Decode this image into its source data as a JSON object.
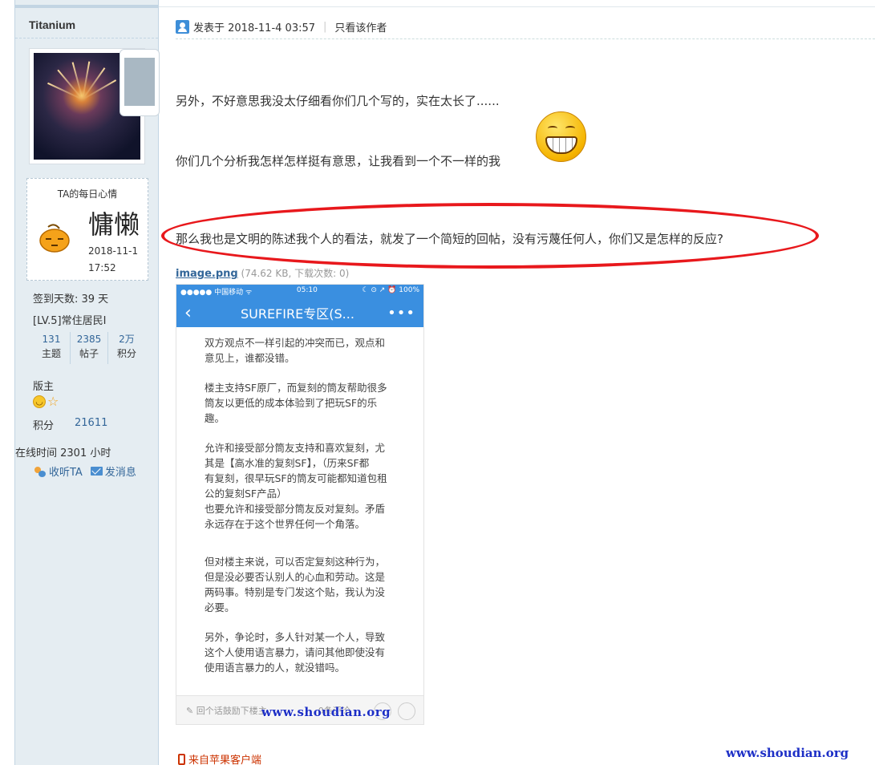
{
  "sidebar": {
    "username": "Titanium",
    "mood": {
      "title": "TA的每日心情",
      "word": "慵懒",
      "date": "2018-11-1",
      "time": "17:52"
    },
    "checkin": "签到天数: 39 天",
    "level": "[LV.5]常住居民I",
    "counts": [
      {
        "num": "131",
        "label": "主题"
      },
      {
        "num": "2385",
        "label": "帖子"
      },
      {
        "num": "2万",
        "label": "积分"
      }
    ],
    "role": "版主",
    "score_label": "积分",
    "score_value": "21611",
    "online": "在线时间  2301 小时",
    "follow_label": "收听TA",
    "message_label": "发消息"
  },
  "post": {
    "meta_time": "发表于 2018-11-4 03:57",
    "meta_sep": "|",
    "meta_author_only": "只看该作者",
    "para1": "另外，不好意思我没太仔细看你们几个写的，实在太长了......",
    "para2": "你们几个分析我怎样怎样挺有意思，让我看到一个不一样的我",
    "para3": "那么我也是文明的陈述我个人的看法，就发了一个简短的回帖，没有污蔑任何人，你们又是怎样的反应?",
    "attachment_name": "image.png",
    "attachment_info": "(74.62 KB, 下载次数: 0)",
    "from_client": "来自苹果客户端"
  },
  "screenshot": {
    "status_left": "●●●●● 中国移动 ᯤ",
    "status_time": "05:10",
    "status_right": "☾ ⊙ ↗ ⏰ 100%",
    "nav_back": "‹",
    "nav_title": "SUREFIRE专区(S...",
    "nav_more": "•••",
    "paragraphs": [
      "双方观点不一样引起的冲突而已，观点和\n意见上，谁都没错。",
      "楼主支持SF原厂，而复刻的筒友帮助很多\n筒友以更低的成本体验到了把玩SF的乐\n趣。",
      "允许和接受部分筒友支持和喜欢复刻，尤\n其是【高水准的复刻SF】，（历来SF都\n有复刻，很早玩SF的筒友可能都知道包租\n公的复刻SF产品）\n也要允许和接受部分筒友反对复刻。矛盾\n永远存在于这个世界任何一个角落。",
      "但对楼主来说，可以否定复刻这种行为，\n但是没必要否认别人的心血和劳动。这是\n两码事。特别是专门发这个贴，我认为没\n必要。",
      "另外，争论时，多人针对某一个人，导致\n这个人使用语言暴力，请问其他即使没有\n使用语言暴力的人，就没错吗。"
    ],
    "footer_placeholder": "✎ 回个话鼓励下楼主",
    "footer_comment": "0条评论",
    "watermark": "www.shoudian.org"
  },
  "page_watermark": "www.shoudian.org",
  "colors": {
    "sidebar_bg": "#e5edf2",
    "link": "#336699",
    "highlight_ellipse": "#e8181c",
    "app_blue": "#3a8fe0",
    "client_red": "#cc3300",
    "watermark": "#1d2fc6"
  }
}
